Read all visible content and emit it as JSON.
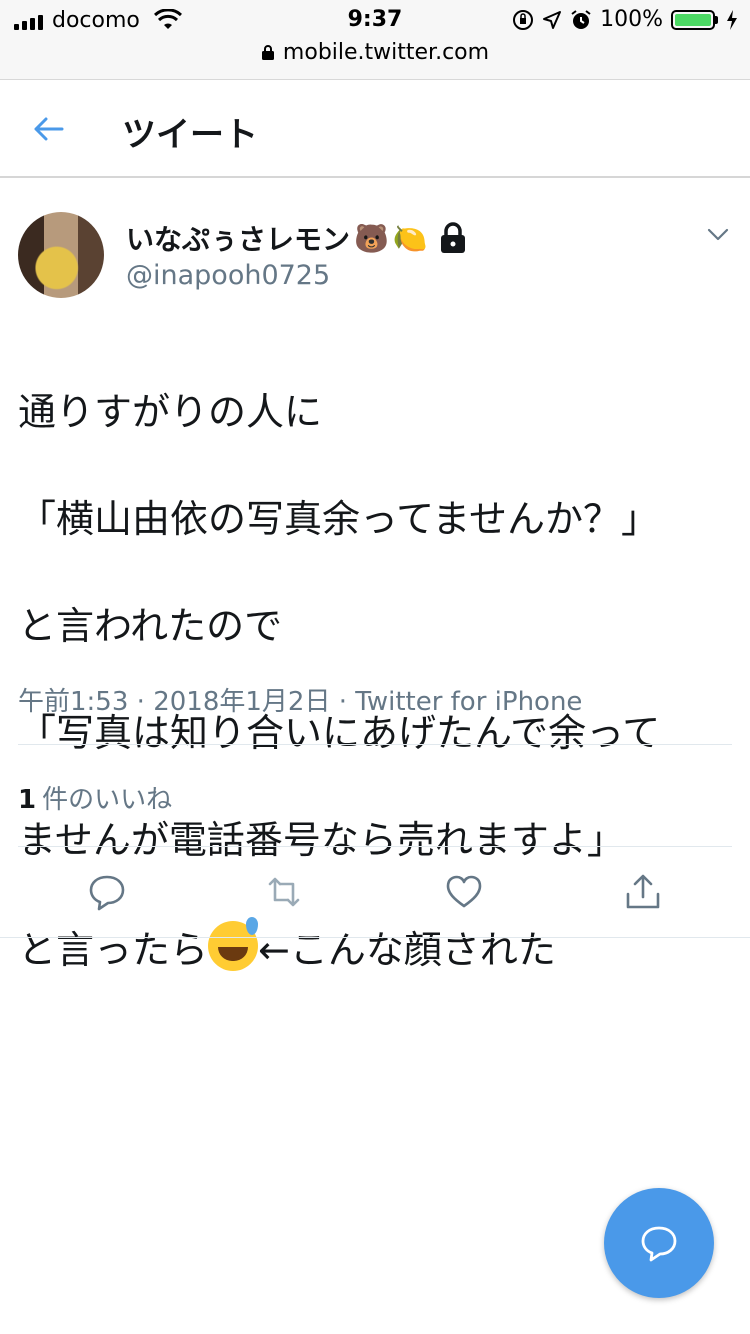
{
  "status_bar": {
    "carrier": "docomo",
    "time": "9:37",
    "battery_percent": "100%",
    "battery_level": 1.0,
    "url": "mobile.twitter.com"
  },
  "header": {
    "title": "ツイート",
    "back_icon": "arrow-left-icon"
  },
  "tweet": {
    "user_name": "いなぷぅさレモン",
    "name_emojis": [
      "🐻",
      "🍋"
    ],
    "protected_icon": "lock-icon",
    "handle": "@inapooh0725",
    "text_lines": [
      "通りすがりの人に",
      "「横山由依の写真余ってませんか？」",
      "と言われたので",
      "「写真は知り合いにあげたんで余って",
      "ませんが電話番号なら売れますよ」"
    ],
    "last_line_before": "と言ったら",
    "last_line_after": "←こんな顔された",
    "timestamp": "午前1:53",
    "date": "2018年1月2日",
    "source": "Twitter for iPhone",
    "separator": "·",
    "likes_count": "1",
    "likes_label": "件のいいね"
  },
  "actions": [
    "reply-icon",
    "retweet-icon",
    "like-icon",
    "share-icon"
  ],
  "colors": {
    "accent": "#4a99e9",
    "secondary_text": "#657786",
    "icon_gray": "#657786",
    "battery_green": "#4cd964"
  }
}
